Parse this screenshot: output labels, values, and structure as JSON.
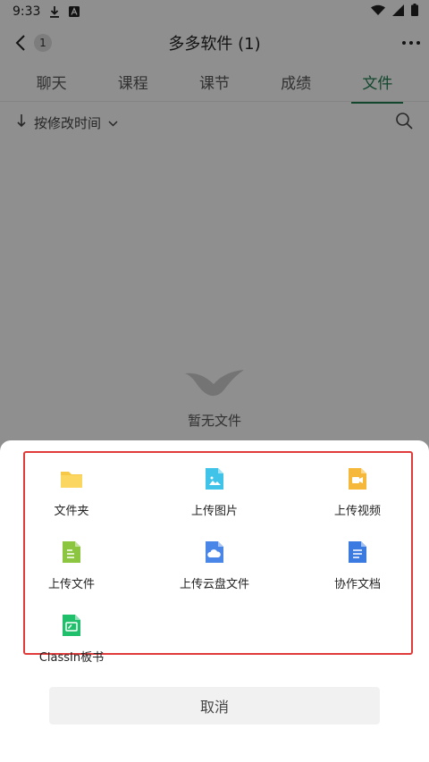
{
  "status_bar": {
    "time": "9:33"
  },
  "header": {
    "back_badge": "1",
    "title": "多多软件 (1)"
  },
  "tabs": [
    {
      "label": "聊天"
    },
    {
      "label": "课程"
    },
    {
      "label": "课节"
    },
    {
      "label": "成绩"
    },
    {
      "label": "文件",
      "active": true
    }
  ],
  "sort": {
    "label": "按修改时间"
  },
  "empty_state": {
    "text": "暂无文件"
  },
  "sheet": {
    "items": [
      {
        "label": "文件夹",
        "icon": "folder-icon"
      },
      {
        "label": "上传图片",
        "icon": "image-icon"
      },
      {
        "label": "上传视频",
        "icon": "video-icon"
      },
      {
        "label": "上传文件",
        "icon": "file-icon"
      },
      {
        "label": "上传云盘文件",
        "icon": "cloud-file-icon"
      },
      {
        "label": "协作文档",
        "icon": "doc-icon"
      },
      {
        "label": "ClassIn板书",
        "icon": "blackboard-icon"
      }
    ],
    "cancel_label": "取消"
  },
  "colors": {
    "accent_green": "#1f7a4f",
    "highlight_red": "#e03a3a",
    "folder_yellow": "#f7c948",
    "image_cyan": "#3fc3e8",
    "video_orange": "#f6b83a",
    "file_green": "#8cc641",
    "cloud_blue": "#4a86e8",
    "doc_blue": "#3b7ae0",
    "board_green": "#1fbf6b"
  }
}
